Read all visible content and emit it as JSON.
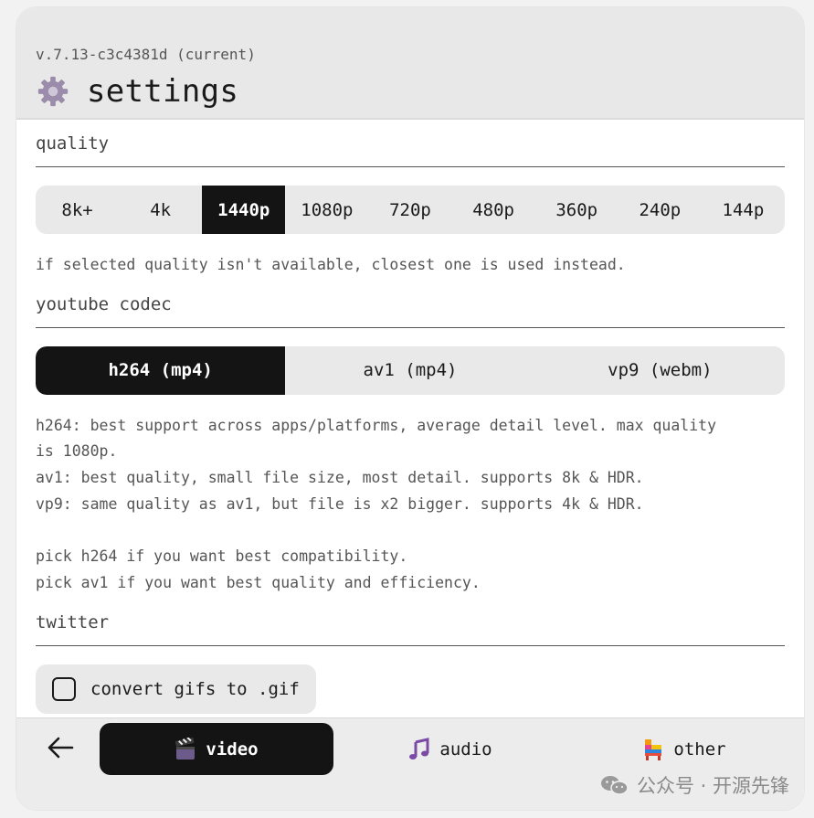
{
  "header": {
    "version": "v.7.13-c3c4381d (current)",
    "title": "settings",
    "icon": "gear-icon"
  },
  "quality": {
    "title": "quality",
    "options": [
      "8k+",
      "4k",
      "1440p",
      "1080p",
      "720p",
      "480p",
      "360p",
      "240p",
      "144p"
    ],
    "selected": "1440p",
    "description": "if selected quality isn't available, closest one is used instead."
  },
  "codec": {
    "title": "youtube codec",
    "options": [
      "h264 (mp4)",
      "av1 (mp4)",
      "vp9 (webm)"
    ],
    "selected": "h264 (mp4)",
    "description": "h264: best support across apps/platforms, average detail level. max quality\nis 1080p.\nav1: best quality, small file size, most detail. supports 8k & HDR.\nvp9: same quality as av1, but file is x2 bigger. supports 4k & HDR.\n\npick h264 if you want best compatibility.\npick av1 if you want best quality and efficiency."
  },
  "twitter": {
    "title": "twitter",
    "checkbox_label": "convert gifs to .gif",
    "checked": false
  },
  "nav": {
    "back_icon": "arrow-left-icon",
    "tabs": [
      {
        "label": "video",
        "icon": "clapper-board-icon",
        "active": true
      },
      {
        "label": "audio",
        "icon": "musical-notes-icon",
        "active": false
      },
      {
        "label": "other",
        "icon": "pinata-icon",
        "active": false
      }
    ]
  },
  "watermark": {
    "text": "公众号 · 开源先锋",
    "icon": "wechat-icon"
  },
  "colors": {
    "active": "#141414",
    "segment_bg": "#e9e9e9",
    "header_bg": "#e8e8e8"
  }
}
